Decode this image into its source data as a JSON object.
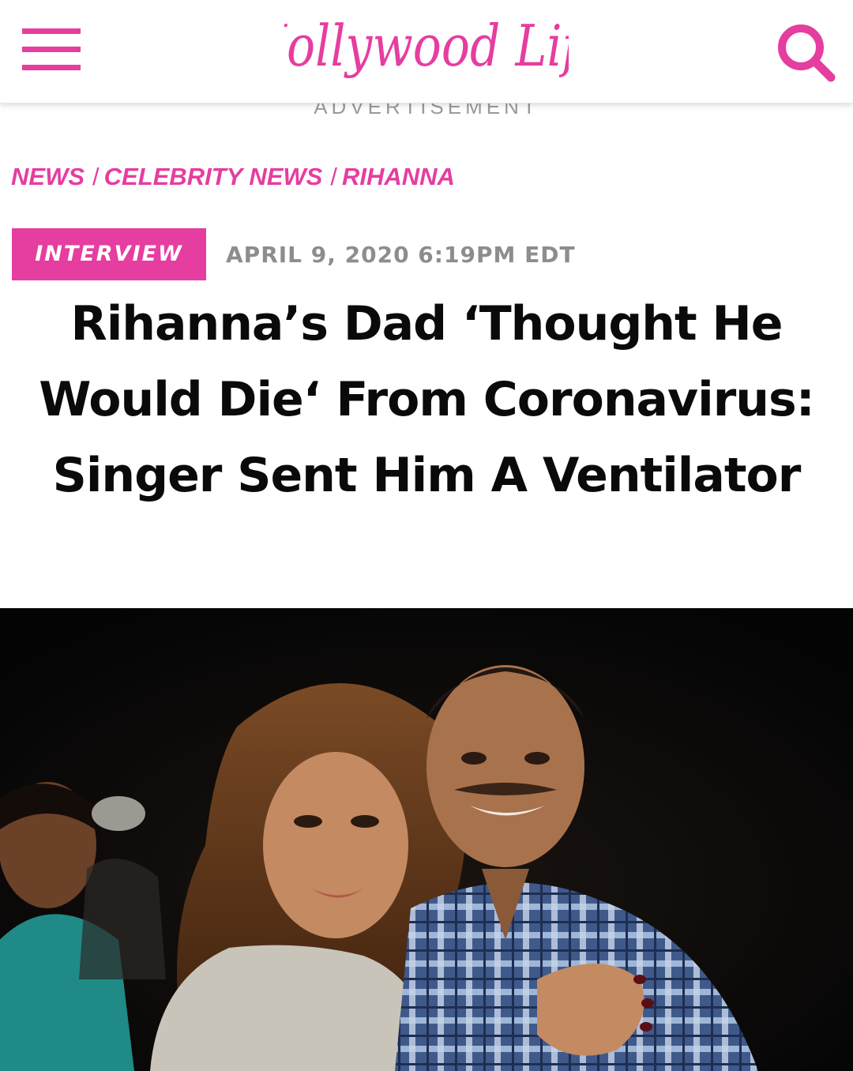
{
  "header": {
    "logo_text": "Hollywood Life",
    "colors": {
      "brand_pink": "#e63da0"
    },
    "icons": {
      "menu": "hamburger-menu-icon",
      "search": "search-icon"
    }
  },
  "ad": {
    "label": "ADVERTISEMENT"
  },
  "breadcrumb": {
    "items": [
      {
        "label": "NEWS"
      },
      {
        "label": "CELEBRITY NEWS"
      },
      {
        "label": "RIHANNA"
      }
    ],
    "separator": "/"
  },
  "article": {
    "tag": "INTERVIEW",
    "date": "APRIL 9, 2020 6:19PM EDT",
    "headline": "Rihanna’s Dad ‘Thought He Would Die‘ From Coronavirus: Singer Sent Him A Ventilator"
  },
  "hero_image": {
    "subject": "rihanna-and-father-photo"
  }
}
